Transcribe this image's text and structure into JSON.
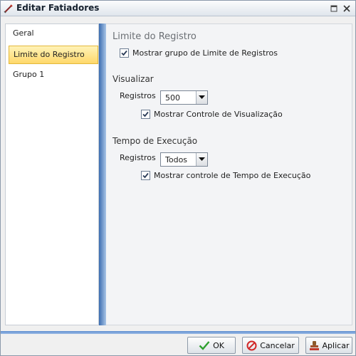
{
  "window": {
    "title": "Editar Fatiadores"
  },
  "sidebar": {
    "items": [
      {
        "label": "Geral"
      },
      {
        "label": "Limite do Registro",
        "selected": true
      },
      {
        "label": "Grupo 1"
      }
    ]
  },
  "content": {
    "header": "Limite do Registro",
    "limit_checkbox": {
      "label": "Mostrar grupo de Limite de Registros",
      "checked": true
    },
    "visualizar": {
      "title": "Visualizar",
      "registros_label": "Registros",
      "registros_value": "500",
      "checkbox": {
        "label": "Mostrar Controle de Visualização",
        "checked": true
      }
    },
    "tempo": {
      "title": "Tempo de Execução",
      "registros_label": "Registros",
      "registros_value": "Todos",
      "checkbox": {
        "label": "Mostrar controle de Tempo de Execução",
        "checked": true
      }
    }
  },
  "footer": {
    "ok_label": "OK",
    "cancel_label": "Cancelar",
    "apply_label": "Aplicar"
  },
  "icons": {
    "title": "slicer-icon",
    "restore": "restore-icon",
    "close": "close-icon",
    "ok": "check-icon",
    "cancel": "cancel-icon",
    "apply": "apply-stamp-icon"
  },
  "colors": {
    "accent": "#3c6db0",
    "selection": "#ffd86a",
    "ok_check": "#2ea02e",
    "cancel_red": "#d12a2a"
  }
}
